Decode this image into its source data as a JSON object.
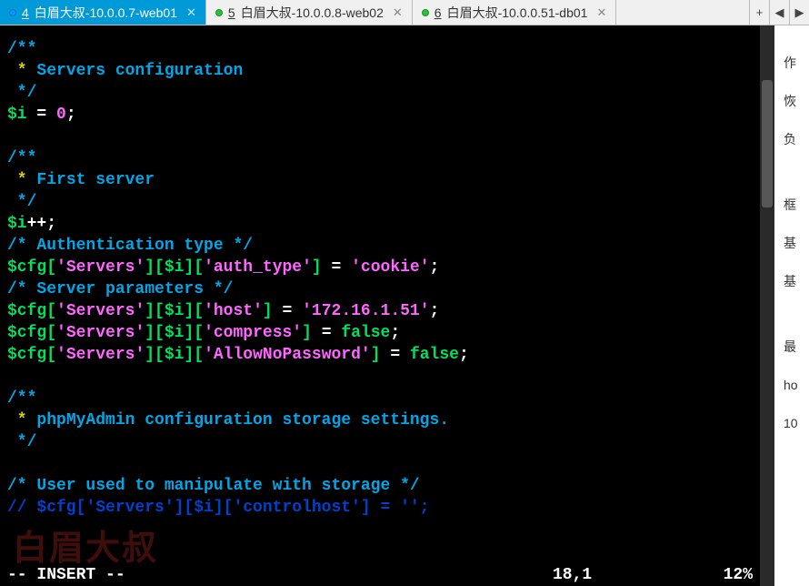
{
  "tabs": [
    {
      "num": "4",
      "label": "白眉大叔-10.0.0.7-web01",
      "active": true,
      "dot": "blue"
    },
    {
      "num": "5",
      "label": "白眉大叔-10.0.0.8-web02",
      "active": false,
      "dot": "green"
    },
    {
      "num": "6",
      "label": "白眉大叔-10.0.0.51-db01",
      "active": false,
      "dot": "green"
    }
  ],
  "tab_controls": {
    "add": "+",
    "prev": "◀",
    "next": "▶"
  },
  "code": {
    "l1": "/**",
    "l2a": " *",
    "l2b": " Servers configuration",
    "l3": " */",
    "l4_var": "$i",
    "l4_eq": " = ",
    "l4_num": "0",
    "l4_semi": ";",
    "l5blank": "",
    "l6": "/**",
    "l7a": " *",
    "l7b": " First server",
    "l8": " */",
    "l9_var": "$i",
    "l9_pp": "++",
    "l9_semi": ";",
    "l10": "/* Authentication type */",
    "l11_cfg": "$cfg",
    "l11_b1": "[",
    "l11_k1": "'Servers'",
    "l11_b2": "][",
    "l11_k2": "$i",
    "l11_b3": "][",
    "l11_k3": "'auth_type'",
    "l11_b4": "]",
    "l11_eq": " = ",
    "l11_v": "'cookie'",
    "l11_s": ";",
    "l12": "/* Server parameters */",
    "l13_cfg": "$cfg",
    "l13_b1": "[",
    "l13_k1": "'Servers'",
    "l13_b2": "][",
    "l13_k2": "$i",
    "l13_b3": "][",
    "l13_k3": "'host'",
    "l13_b4": "]",
    "l13_eq": " = ",
    "l13_v": "'172.16.1.51'",
    "l13_s": ";",
    "l14_cfg": "$cfg",
    "l14_b1": "[",
    "l14_k1": "'Servers'",
    "l14_b2": "][",
    "l14_k2": "$i",
    "l14_b3": "][",
    "l14_k3": "'compress'",
    "l14_b4": "]",
    "l14_eq": " = ",
    "l14_v": "false",
    "l14_s": ";",
    "l15_cfg": "$cfg",
    "l15_b1": "[",
    "l15_k1": "'Servers'",
    "l15_b2": "][",
    "l15_k2": "$i",
    "l15_b3": "][",
    "l15_k3": "'AllowNoPassword'",
    "l15_b4": "]",
    "l15_eq": " = ",
    "l15_v": "false",
    "l15_s": ";",
    "l16blank": "",
    "l17": "/**",
    "l18a": " *",
    "l18b": " phpMyAdmin configuration storage settings.",
    "l19": " */",
    "l20blank": "",
    "l21": "/* User used to manipulate with storage */",
    "l22": "// $cfg['Servers'][$i]['controlhost'] = '';"
  },
  "status": {
    "mode": "-- INSERT --",
    "position": "18,1",
    "percent": "12%"
  },
  "watermark": "白眉大叔",
  "sidepanel": {
    "items": [
      "作",
      "恢",
      "负",
      "框",
      "基",
      "基",
      "最",
      "ho",
      "10"
    ]
  }
}
